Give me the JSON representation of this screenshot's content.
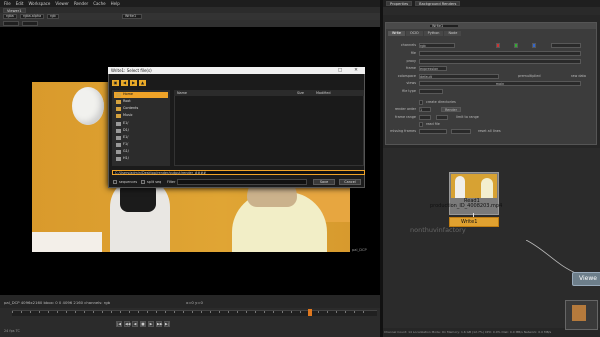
{
  "menubar": [
    "File",
    "Edit",
    "Workspace",
    "Viewer",
    "Render",
    "Cache",
    "Help"
  ],
  "viewer": {
    "tab_label": "Viewer1",
    "toolbar": {
      "channels": "rgba",
      "channel": "rgba.alpha",
      "layer": "rgb",
      "write": "Write1"
    },
    "frame_label": "pal_DCP",
    "info_text": "pal_DCP 4096x2160  bbox: 0 0 4096 2160 channels: rgb",
    "zoom_text": "x=0 y=0"
  },
  "transport": {
    "buttons": [
      "|◀",
      "◀◀",
      "◀",
      "■",
      "▶",
      "▶▶",
      "▶|"
    ]
  },
  "status_left": "24  fps  TC",
  "props": {
    "tabs": [
      "Properties",
      "Background Renders"
    ],
    "node_name": "Write1",
    "subtabs": [
      "Write",
      "OCIO",
      "Python",
      "Node"
    ],
    "rows": [
      {
        "label": "channels",
        "value": "rgb"
      },
      {
        "label": "file",
        "value": ""
      },
      {
        "label": "proxy",
        "value": ""
      },
      {
        "label": "frame",
        "value": "expression"
      },
      {
        "label": "colorspace",
        "value": "default"
      },
      {
        "label": "views",
        "value": "main"
      },
      {
        "label": "file type",
        "value": ""
      }
    ],
    "create_dirs": "create directories",
    "render_order_label": "render order",
    "render_order_value": "1",
    "render_btn": "Render",
    "frame_range_label": "frame range",
    "read_file_label": "read file",
    "missing_frames_label": "missing frames",
    "premultiplied": "premultiplied",
    "raw_data": "raw data",
    "limit_to_range": "limit to range",
    "reset_all": "reset all lines"
  },
  "nodegraph": {
    "read_label": "Read1",
    "read_file": "production_ID_4008203.mp4",
    "write_label": "Write1",
    "viewer_label": "Viewe",
    "watermark": "nonthuvinfactory"
  },
  "status_right": "Channel Count: 14  Localization Mode: On  Memory: 1.6 GB (12.7%)  CPU: 0.0%  Disk: 0.0 MB/s  Network: 0.0 MB/s",
  "dialog": {
    "title": "Write1: Select file(s)",
    "toolbar_icons": [
      "folder-icon",
      "back-icon",
      "forward-icon",
      "up-icon"
    ],
    "sidebar": [
      "Home",
      "Root",
      "Contents",
      "Music",
      "E1/",
      "D1/",
      "E1/",
      "F1/",
      "G1/",
      "H1/"
    ],
    "columns": [
      "Name",
      "Size",
      "Modified"
    ],
    "path": "C:/Users/admin/Desktop/render/output/render_####",
    "sequence_label": "sequences",
    "split_seq_label": "split seq",
    "filter_label": "Filter",
    "save_btn": "Save",
    "cancel_btn": "Cancel"
  }
}
